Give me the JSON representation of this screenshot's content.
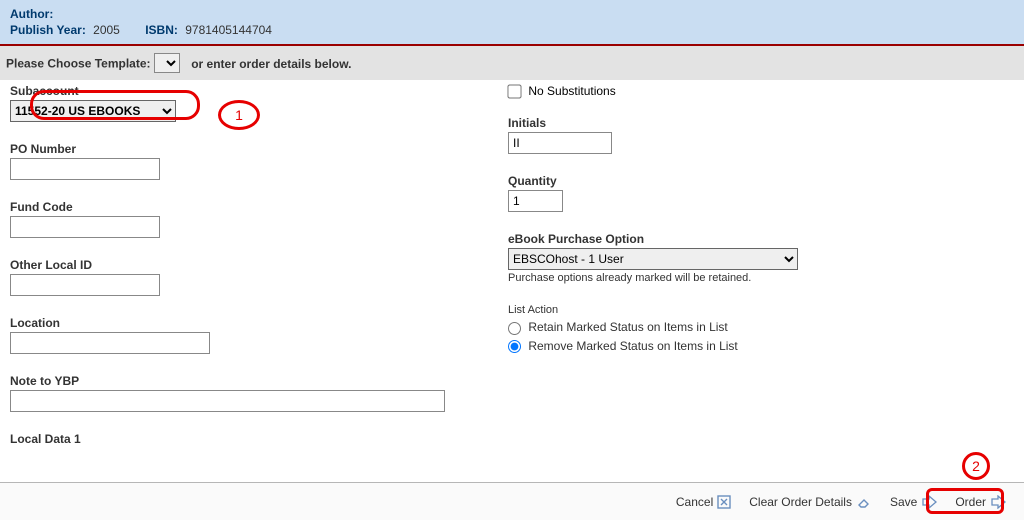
{
  "info": {
    "author_label": "Author:",
    "author": "",
    "year_label": "Publish Year:",
    "year": "2005",
    "isbn_label": "ISBN:",
    "isbn": "9781405144704"
  },
  "template_bar": {
    "prompt": "Please Choose Template:",
    "or_text": "or enter order details below."
  },
  "left": {
    "subaccount_label": "Subaccount",
    "subaccount_value": "11552-20 US EBOOKS",
    "po_label": "PO Number",
    "po_value": "",
    "fund_label": "Fund Code",
    "fund_value": "",
    "other_label": "Other Local ID",
    "other_value": "",
    "location_label": "Location",
    "location_value": "",
    "note_label": "Note to YBP",
    "note_value": "",
    "local1_label": "Local Data 1"
  },
  "right": {
    "nosub_label": "No Substitutions",
    "initials_label": "Initials",
    "initials_value": "II",
    "qty_label": "Quantity",
    "qty_value": "1",
    "ebook_label": "eBook Purchase Option",
    "ebook_value": "EBSCOhost - 1 User",
    "ebook_hint": "Purchase options already marked will be retained.",
    "list_action_label": "List Action",
    "radio_retain": "Retain Marked Status on Items in List",
    "radio_remove": "Remove Marked Status on Items in List"
  },
  "footer": {
    "cancel": "Cancel",
    "clear": "Clear Order Details",
    "save": "Save",
    "order": "Order"
  },
  "annotations": {
    "one": "1",
    "two": "2"
  }
}
